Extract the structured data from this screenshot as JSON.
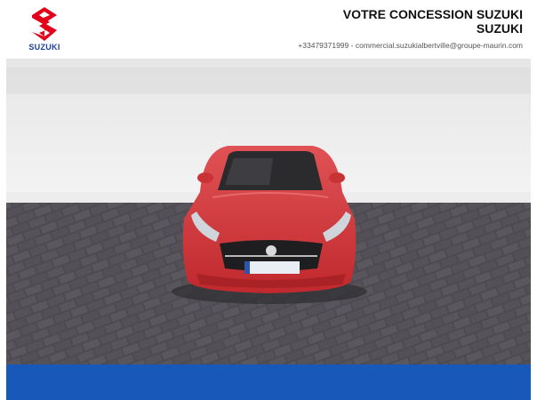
{
  "brand": {
    "logo_text": "SUZUKI",
    "logo_color": "#e2001a",
    "logo_text_color": "#1b3f94"
  },
  "dealer": {
    "title_line1": "VOTRE CONCESSION SUZUKI",
    "title_line2": "SUZUKI",
    "phone": "+33479371999",
    "separator": "-",
    "email": "commercial.suzukialbertville@groupe-maurin.com"
  },
  "colors": {
    "footer_bar": "#1858b8",
    "car_body": "#d23a3c"
  },
  "icons": {
    "logo": "suzuki-s-logo-icon"
  }
}
